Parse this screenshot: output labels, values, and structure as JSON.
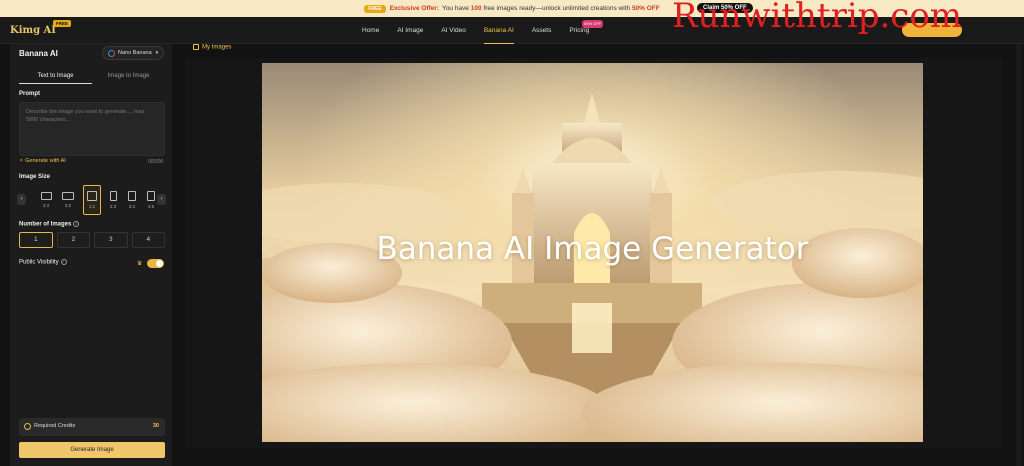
{
  "promo": {
    "tag": "FREE",
    "title": "Exclusive Offer:",
    "text_a": "You have",
    "count": "100",
    "text_b": "free images ready—unlock unlimited creations with",
    "discount": "50% OFF",
    "claim_label": "Claim 50% OFF"
  },
  "header": {
    "logo": "Kimg AI",
    "logo_badge": "FREE",
    "nav": [
      "Home",
      "AI Image",
      "AI Video",
      "Banana AI",
      "Assets",
      "Pricing"
    ],
    "active_nav": "Banana AI",
    "pricing_badge": "50% OFF",
    "watermark": "Runwithtrip.com"
  },
  "sidebar": {
    "title": "Banana AI",
    "model": "Nano Banana",
    "tabs": [
      "Text to Image",
      "Image to Image"
    ],
    "prompt_label": "Prompt",
    "prompt_placeholder": "Describe the image you want to generate..., max 5000 characters...",
    "generate_with_ai": "Generate with AI",
    "char_count": "0/5000",
    "size_label": "Image Size",
    "sizes": [
      "4:3",
      "3:2",
      "1:1",
      "2:3",
      "3:4",
      "4:5"
    ],
    "selected_size": "1:1",
    "num_label": "Number of Images",
    "nums": [
      "1",
      "2",
      "3",
      "4"
    ],
    "selected_num": "1",
    "visibility_label": "Public Visibility",
    "visibility_on": true,
    "credits_label": "Required Credits",
    "credits_value": "30",
    "generate_label": "Generate Image"
  },
  "main": {
    "my_images": "My Images",
    "hero_title": "Banana AI Image Generator"
  },
  "colors": {
    "accent": "#f0c24a",
    "promo_red": "#d4381e",
    "bg": "#121212",
    "panel": "#1c1c1c"
  }
}
